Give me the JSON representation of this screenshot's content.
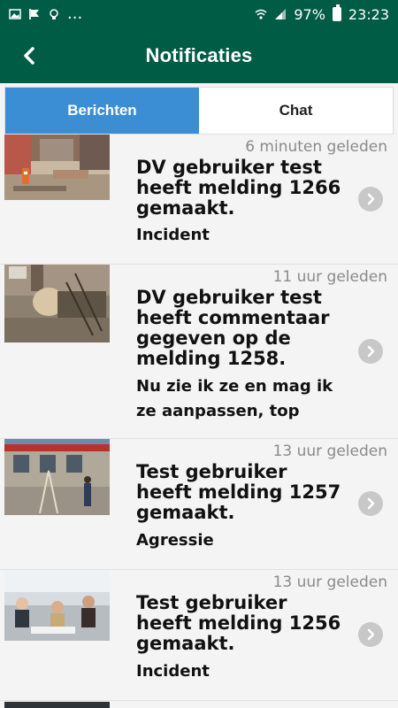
{
  "status_bar": {
    "battery": "97%",
    "time": "23:23",
    "dots": "..."
  },
  "header": {
    "title": "Notificaties"
  },
  "tabs": [
    {
      "label": "Berichten",
      "active": true
    },
    {
      "label": "Chat",
      "active": false
    }
  ],
  "notifications": [
    {
      "time": "6 minuten geleden",
      "title": "DV gebruiker test heeft melding 1266 gemaakt.",
      "subtitle": "Incident"
    },
    {
      "time": "11 uur geleden",
      "title": "DV gebruiker test heeft commentaar gegeven op de melding 1258.",
      "subtitle": "Nu zie ik ze en mag ik ze aanpassen, top"
    },
    {
      "time": "13 uur geleden",
      "title": "Test gebruiker heeft melding 1257 gemaakt.",
      "subtitle": "Agressie"
    },
    {
      "time": "13 uur geleden",
      "title": "Test gebruiker heeft melding 1256 gemaakt.",
      "subtitle": "Incident"
    }
  ],
  "colors": {
    "header_bg": "#005c45",
    "tab_active": "#3c8ed4"
  }
}
